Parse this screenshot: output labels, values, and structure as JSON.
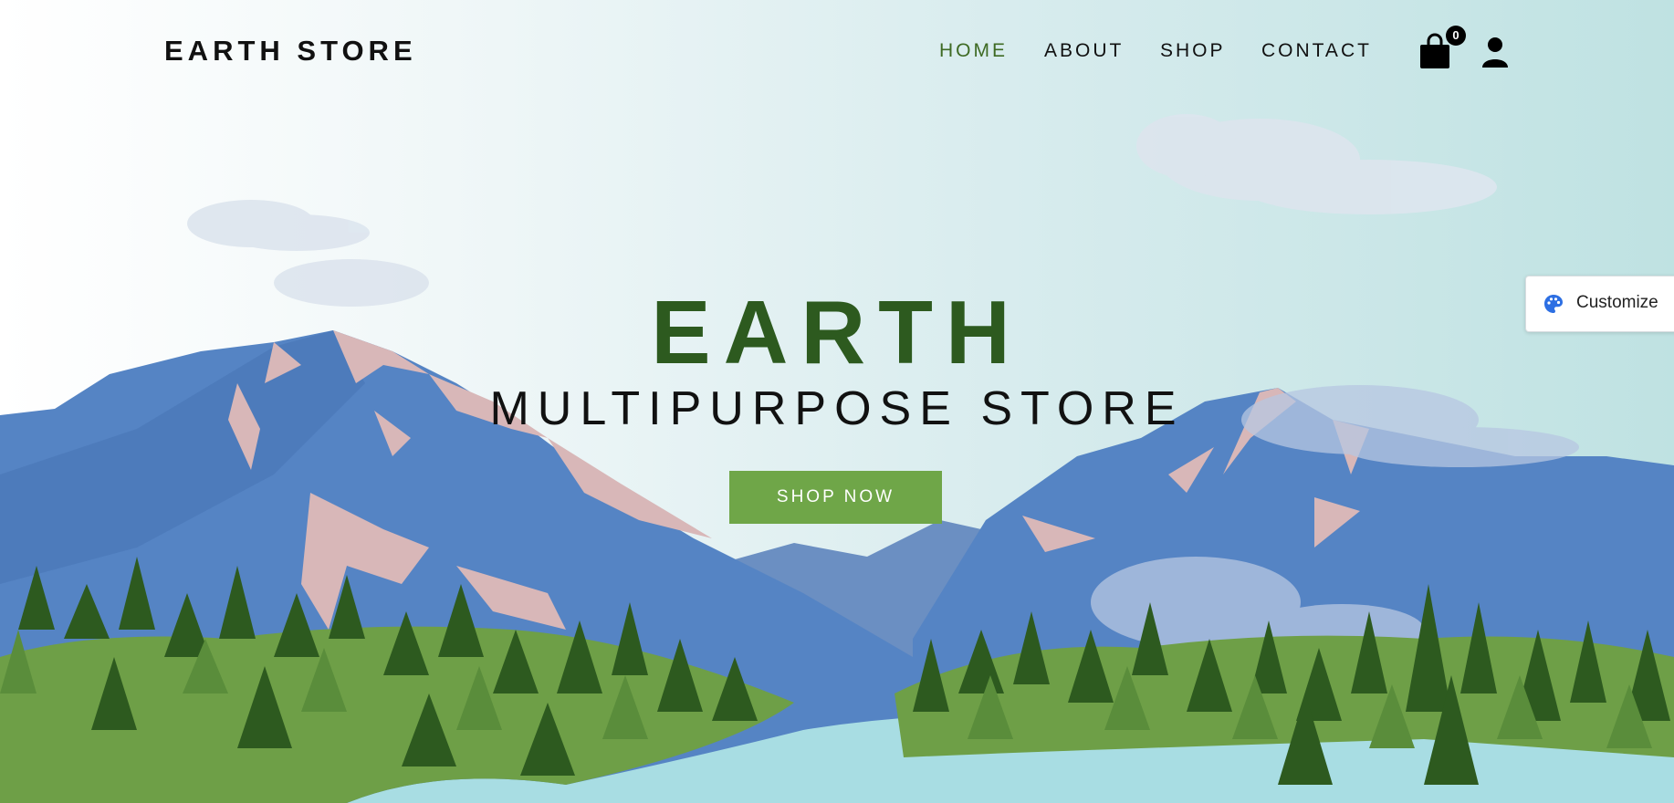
{
  "brand": {
    "logo": "EARTH STORE"
  },
  "nav": {
    "items": [
      {
        "label": "HOME",
        "active": true
      },
      {
        "label": "ABOUT",
        "active": false
      },
      {
        "label": "SHOP",
        "active": false
      },
      {
        "label": "CONTACT",
        "active": false
      }
    ],
    "cart_count": "0",
    "cart_icon": "shopping-bag-icon",
    "user_icon": "user-icon"
  },
  "hero": {
    "title": "EARTH",
    "subtitle": "MULTIPURPOSE STORE",
    "cta_label": "SHOP NOW"
  },
  "customize": {
    "label": "Customize",
    "icon": "palette-icon"
  },
  "colors": {
    "accent_green": "#6fa648",
    "title_green": "#2d5a1f",
    "active_nav": "#3e6a23",
    "mountain_blue": "#4f7fbf",
    "lake": "#a8dde3"
  }
}
